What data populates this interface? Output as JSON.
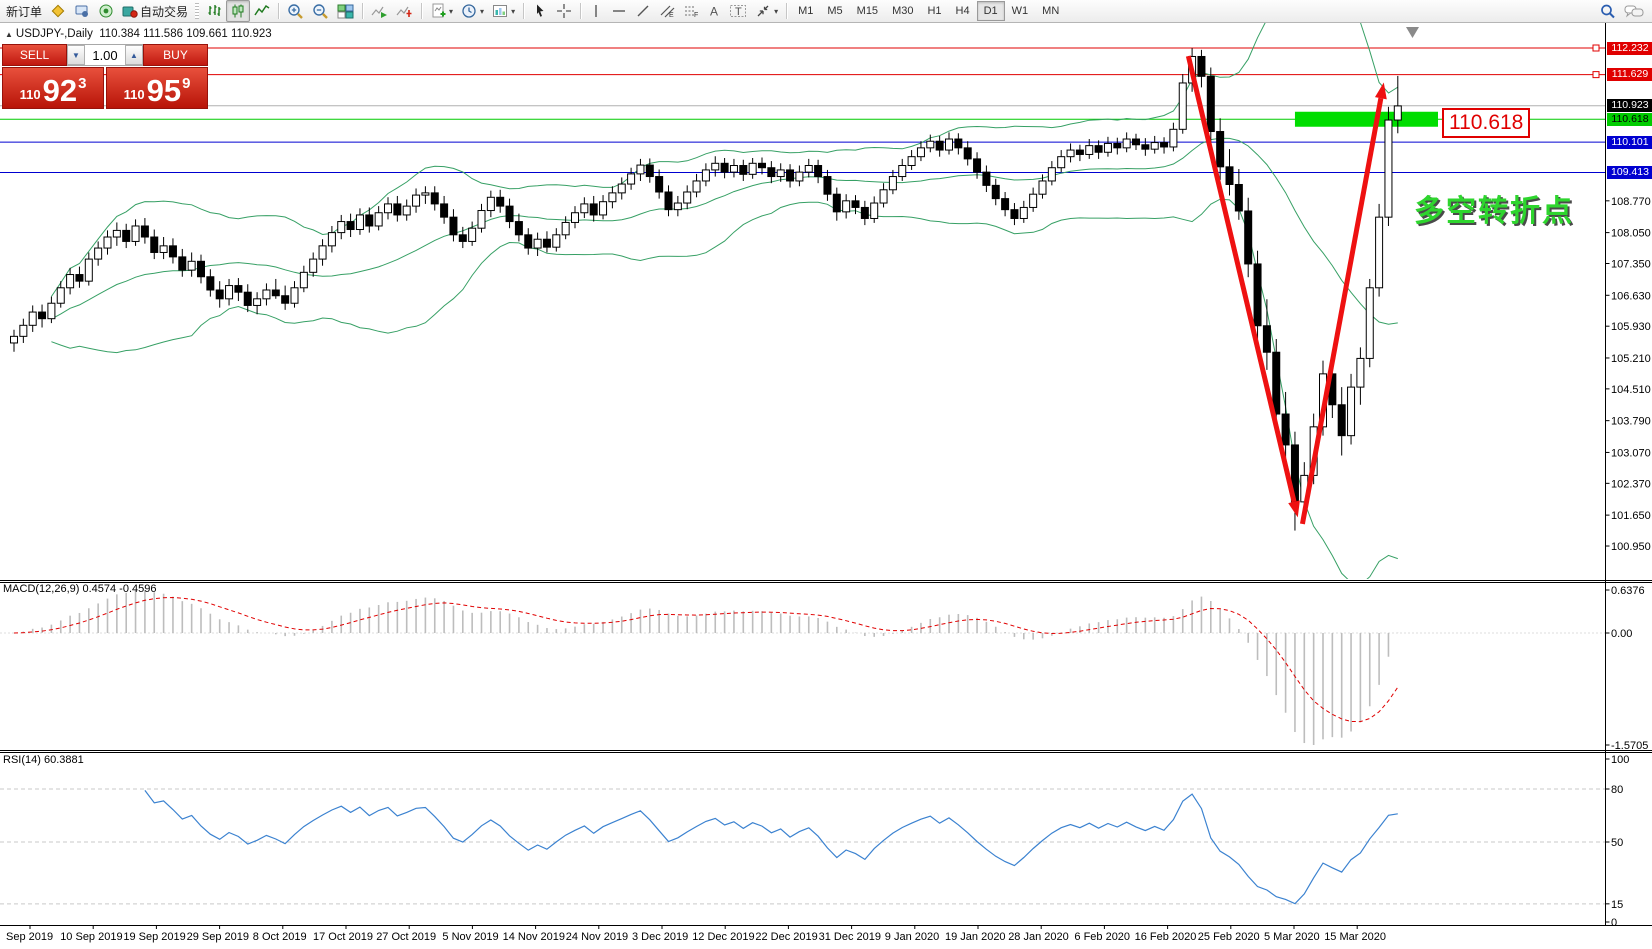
{
  "toolbar": {
    "new_order_label": "新订单",
    "autotrade_label": "自动交易",
    "timeframes": [
      "M1",
      "M5",
      "M15",
      "M30",
      "H1",
      "H4",
      "D1",
      "W1",
      "MN"
    ],
    "active_timeframe": "D1",
    "dropdown_glyph": "▾"
  },
  "chart_header": {
    "collapse_glyph": "▲",
    "title": "USDJPY-,Daily",
    "ohlc": "110.384 111.586 109.661 110.923"
  },
  "trade_panel": {
    "sell_label": "SELL",
    "buy_label": "BUY",
    "volume": "1.00",
    "down_glyph": "▼",
    "up_glyph": "▲",
    "sell_price_prefix": "110",
    "sell_price_main": "92",
    "sell_price_sup": "3",
    "buy_price_prefix": "110",
    "buy_price_main": "95",
    "buy_price_sup": "9"
  },
  "annotations": {
    "turning_point_text": "多空转折点",
    "level_callout": "110.618"
  },
  "indicator_labels": {
    "macd": "MACD(12,26,9) 0.4574 -0.4596",
    "rsi": "RSI(14) 60.3881"
  },
  "chart_data": {
    "type": "candlestick",
    "symbol": "USDJPY-",
    "timeframe": "Daily",
    "ohlc_display": {
      "open": "110.384",
      "high": "111.586",
      "low": "109.661",
      "close": "110.923"
    },
    "price_axis_ticks": [
      "108.770",
      "108.050",
      "107.350",
      "106.630",
      "105.930",
      "105.210",
      "104.510",
      "103.790",
      "103.070",
      "102.370",
      "101.650",
      "100.950"
    ],
    "price_labels": [
      {
        "text": "112.232",
        "price": 112.232,
        "bg": "#e00000",
        "fg": "#ffffff"
      },
      {
        "text": "111.629",
        "price": 111.629,
        "bg": "#e00000",
        "fg": "#ffffff"
      },
      {
        "text": "110.923",
        "price": 110.923,
        "bg": "#000000",
        "fg": "#ffffff"
      },
      {
        "text": "110.618",
        "price": 110.618,
        "bg": "#00cc00",
        "fg": "#000000"
      },
      {
        "text": "110.101",
        "price": 110.101,
        "bg": "#0000d0",
        "fg": "#ffffff"
      },
      {
        "text": "109.413",
        "price": 109.413,
        "bg": "#0000d0",
        "fg": "#ffffff"
      }
    ],
    "h_lines": [
      {
        "price": 112.232,
        "color": "#e00000",
        "handles": true
      },
      {
        "price": 111.629,
        "color": "#e00000",
        "handles": true
      },
      {
        "price": 110.923,
        "color": "#b0b0b0",
        "handles": false
      },
      {
        "price": 110.618,
        "color": "#00cc00",
        "handles": false
      },
      {
        "price": 110.101,
        "color": "#0000d0",
        "handles": false
      },
      {
        "price": 109.413,
        "color": "#0000d0",
        "handles": false
      }
    ],
    "zone": {
      "price": 110.618,
      "bar_start": 137,
      "bar_end": 152.3,
      "color": "#00dd00"
    },
    "arrows": [
      {
        "from_bar": 125.6,
        "from_price": 112.05,
        "to_bar": 137.3,
        "to_price": 101.6
      },
      {
        "from_bar": 137.8,
        "from_price": 101.45,
        "to_bar": 146.5,
        "to_price": 111.45
      }
    ],
    "arrow_color": "#ee1111",
    "bollinger": {
      "period": 20,
      "deviation": 2,
      "color": "#37a065"
    },
    "candles": [
      [
        105.55,
        105.85,
        105.35,
        105.7
      ],
      [
        105.7,
        106.1,
        105.55,
        105.95
      ],
      [
        105.95,
        106.4,
        105.8,
        106.25
      ],
      [
        106.25,
        106.42,
        105.9,
        106.1
      ],
      [
        106.1,
        106.6,
        106.0,
        106.45
      ],
      [
        106.45,
        106.95,
        106.35,
        106.8
      ],
      [
        106.8,
        107.25,
        106.65,
        107.1
      ],
      [
        107.1,
        107.28,
        106.8,
        106.95
      ],
      [
        106.95,
        107.6,
        106.85,
        107.45
      ],
      [
        107.45,
        107.85,
        107.3,
        107.7
      ],
      [
        107.7,
        108.1,
        107.55,
        107.95
      ],
      [
        107.95,
        108.28,
        107.75,
        108.1
      ],
      [
        108.1,
        108.25,
        107.7,
        107.85
      ],
      [
        107.85,
        108.35,
        107.75,
        108.2
      ],
      [
        108.2,
        108.38,
        107.8,
        107.95
      ],
      [
        107.95,
        108.12,
        107.45,
        107.6
      ],
      [
        107.6,
        107.95,
        107.45,
        107.75
      ],
      [
        107.75,
        107.92,
        107.35,
        107.5
      ],
      [
        107.5,
        107.68,
        107.05,
        107.2
      ],
      [
        107.2,
        107.6,
        107.05,
        107.4
      ],
      [
        107.4,
        107.55,
        106.9,
        107.05
      ],
      [
        107.05,
        107.22,
        106.6,
        106.75
      ],
      [
        106.75,
        106.95,
        106.35,
        106.55
      ],
      [
        106.55,
        107.0,
        106.4,
        106.85
      ],
      [
        106.85,
        107.02,
        106.5,
        106.7
      ],
      [
        106.7,
        106.88,
        106.25,
        106.4
      ],
      [
        106.4,
        106.7,
        106.2,
        106.55
      ],
      [
        106.55,
        106.9,
        106.4,
        106.75
      ],
      [
        106.75,
        107.0,
        106.55,
        106.62
      ],
      [
        106.62,
        106.85,
        106.3,
        106.45
      ],
      [
        106.45,
        106.95,
        106.35,
        106.8
      ],
      [
        106.8,
        107.3,
        106.7,
        107.15
      ],
      [
        107.15,
        107.6,
        107.05,
        107.45
      ],
      [
        107.45,
        107.9,
        107.3,
        107.75
      ],
      [
        107.75,
        108.2,
        107.6,
        108.05
      ],
      [
        108.05,
        108.45,
        107.9,
        108.3
      ],
      [
        108.3,
        108.48,
        107.95,
        108.12
      ],
      [
        108.12,
        108.6,
        108.0,
        108.45
      ],
      [
        108.45,
        108.62,
        108.05,
        108.2
      ],
      [
        108.2,
        108.65,
        108.1,
        108.5
      ],
      [
        108.5,
        108.85,
        108.35,
        108.7
      ],
      [
        108.7,
        108.88,
        108.3,
        108.45
      ],
      [
        108.45,
        108.8,
        108.32,
        108.65
      ],
      [
        108.65,
        109.05,
        108.5,
        108.9
      ],
      [
        108.9,
        109.1,
        108.7,
        108.95
      ],
      [
        108.95,
        109.1,
        108.55,
        108.7
      ],
      [
        108.7,
        108.88,
        108.25,
        108.4
      ],
      [
        108.4,
        108.58,
        107.85,
        108.0
      ],
      [
        108.0,
        108.18,
        107.7,
        107.85
      ],
      [
        107.85,
        108.3,
        107.75,
        108.15
      ],
      [
        108.15,
        108.7,
        108.05,
        108.55
      ],
      [
        108.55,
        109.0,
        108.4,
        108.85
      ],
      [
        108.85,
        109.02,
        108.5,
        108.65
      ],
      [
        108.65,
        108.82,
        108.15,
        108.3
      ],
      [
        108.3,
        108.48,
        107.85,
        108.0
      ],
      [
        108.0,
        108.15,
        107.55,
        107.7
      ],
      [
        107.7,
        108.05,
        107.52,
        107.9
      ],
      [
        107.9,
        108.08,
        107.6,
        107.72
      ],
      [
        107.72,
        108.15,
        107.62,
        108.0
      ],
      [
        108.0,
        108.42,
        107.9,
        108.28
      ],
      [
        108.28,
        108.65,
        108.15,
        108.5
      ],
      [
        108.5,
        108.85,
        108.38,
        108.7
      ],
      [
        108.7,
        108.88,
        108.3,
        108.45
      ],
      [
        108.45,
        108.9,
        108.35,
        108.75
      ],
      [
        108.75,
        109.1,
        108.6,
        108.95
      ],
      [
        108.95,
        109.3,
        108.8,
        109.15
      ],
      [
        109.15,
        109.52,
        109.02,
        109.38
      ],
      [
        109.38,
        109.72,
        109.22,
        109.58
      ],
      [
        109.58,
        109.73,
        109.18,
        109.32
      ],
      [
        109.32,
        109.48,
        108.82,
        108.97
      ],
      [
        108.97,
        109.12,
        108.42,
        108.57
      ],
      [
        108.57,
        108.88,
        108.42,
        108.72
      ],
      [
        108.72,
        109.12,
        108.58,
        108.97
      ],
      [
        108.97,
        109.38,
        108.85,
        109.22
      ],
      [
        109.22,
        109.62,
        109.1,
        109.47
      ],
      [
        109.47,
        109.78,
        109.32,
        109.62
      ],
      [
        109.62,
        109.74,
        109.28,
        109.42
      ],
      [
        109.42,
        109.72,
        109.3,
        109.57
      ],
      [
        109.57,
        109.7,
        109.22,
        109.37
      ],
      [
        109.37,
        109.74,
        109.27,
        109.62
      ],
      [
        109.62,
        109.75,
        109.37,
        109.52
      ],
      [
        109.52,
        109.67,
        109.17,
        109.32
      ],
      [
        109.32,
        109.62,
        109.2,
        109.47
      ],
      [
        109.47,
        109.6,
        109.07,
        109.22
      ],
      [
        109.22,
        109.57,
        109.1,
        109.42
      ],
      [
        109.42,
        109.72,
        109.3,
        109.57
      ],
      [
        109.57,
        109.7,
        109.17,
        109.32
      ],
      [
        109.32,
        109.47,
        108.77,
        108.92
      ],
      [
        108.92,
        109.07,
        108.32,
        108.52
      ],
      [
        108.52,
        108.92,
        108.37,
        108.77
      ],
      [
        108.77,
        108.9,
        108.47,
        108.62
      ],
      [
        108.62,
        108.77,
        108.22,
        108.37
      ],
      [
        108.37,
        108.87,
        108.27,
        108.72
      ],
      [
        108.72,
        109.17,
        108.62,
        109.02
      ],
      [
        109.02,
        109.47,
        108.92,
        109.32
      ],
      [
        109.32,
        109.72,
        109.22,
        109.57
      ],
      [
        109.57,
        109.92,
        109.47,
        109.77
      ],
      [
        109.77,
        110.12,
        109.67,
        109.97
      ],
      [
        109.97,
        110.27,
        109.87,
        110.12
      ],
      [
        110.12,
        110.24,
        109.77,
        109.92
      ],
      [
        109.92,
        110.32,
        109.82,
        110.17
      ],
      [
        110.17,
        110.3,
        109.82,
        109.97
      ],
      [
        109.97,
        110.12,
        109.57,
        109.72
      ],
      [
        109.72,
        109.87,
        109.27,
        109.42
      ],
      [
        109.42,
        109.57,
        108.97,
        109.12
      ],
      [
        109.12,
        109.27,
        108.67,
        108.82
      ],
      [
        108.82,
        108.97,
        108.42,
        108.57
      ],
      [
        108.57,
        108.72,
        108.22,
        108.37
      ],
      [
        108.37,
        108.77,
        108.27,
        108.62
      ],
      [
        108.62,
        109.07,
        108.52,
        108.92
      ],
      [
        108.92,
        109.37,
        108.82,
        109.22
      ],
      [
        109.22,
        109.67,
        109.12,
        109.52
      ],
      [
        109.52,
        109.92,
        109.42,
        109.77
      ],
      [
        109.77,
        110.07,
        109.64,
        109.92
      ],
      [
        109.92,
        110.04,
        109.67,
        109.82
      ],
      [
        109.82,
        110.17,
        109.72,
        110.02
      ],
      [
        110.02,
        110.14,
        109.72,
        109.87
      ],
      [
        109.87,
        110.22,
        109.77,
        110.07
      ],
      [
        110.07,
        110.2,
        109.82,
        109.97
      ],
      [
        109.97,
        110.32,
        109.87,
        110.17
      ],
      [
        110.17,
        110.29,
        109.92,
        110.04
      ],
      [
        110.04,
        110.19,
        109.79,
        109.94
      ],
      [
        109.94,
        110.24,
        109.84,
        110.09
      ],
      [
        110.09,
        110.21,
        109.84,
        109.99
      ],
      [
        109.99,
        110.54,
        109.89,
        110.39
      ],
      [
        110.39,
        111.64,
        110.29,
        111.44
      ],
      [
        111.44,
        112.23,
        111.24,
        112.04
      ],
      [
        112.04,
        112.19,
        111.34,
        111.59
      ],
      [
        111.59,
        111.79,
        110.09,
        110.34
      ],
      [
        110.34,
        110.64,
        109.24,
        109.54
      ],
      [
        109.54,
        109.94,
        108.89,
        109.14
      ],
      [
        109.14,
        109.49,
        108.34,
        108.54
      ],
      [
        108.54,
        108.84,
        107.04,
        107.34
      ],
      [
        107.34,
        107.64,
        105.64,
        105.94
      ],
      [
        105.94,
        106.54,
        104.94,
        105.34
      ],
      [
        105.34,
        105.64,
        103.54,
        103.94
      ],
      [
        103.94,
        104.44,
        102.94,
        103.24
      ],
      [
        103.24,
        103.54,
        101.3,
        101.95
      ],
      [
        101.95,
        102.85,
        101.45,
        102.55
      ],
      [
        102.55,
        103.95,
        102.35,
        103.65
      ],
      [
        103.65,
        105.15,
        103.45,
        104.85
      ],
      [
        104.85,
        105.05,
        103.85,
        104.15
      ],
      [
        104.15,
        104.55,
        103.0,
        103.45
      ],
      [
        103.45,
        104.85,
        103.25,
        104.55
      ],
      [
        104.55,
        105.45,
        104.15,
        105.2
      ],
      [
        105.2,
        107.0,
        105.0,
        106.8
      ],
      [
        106.8,
        108.7,
        106.6,
        108.4
      ],
      [
        108.4,
        110.9,
        108.2,
        110.6
      ],
      [
        110.6,
        111.6,
        110.3,
        110.92
      ]
    ],
    "x_axis_dates": [
      "Sep 2019",
      "10 Sep 2019",
      "19 Sep 2019",
      "29 Sep 2019",
      "8 Oct 2019",
      "17 Oct 2019",
      "27 Oct 2019",
      "5 Nov 2019",
      "14 Nov 2019",
      "24 Nov 2019",
      "3 Dec 2019",
      "12 Dec 2019",
      "22 Dec 2019",
      "31 Dec 2019",
      "9 Jan 2020",
      "19 Jan 2020",
      "28 Jan 2020",
      "6 Feb 2020",
      "16 Feb 2020",
      "25 Feb 2020",
      "5 Mar 2020",
      "15 Mar 2020"
    ],
    "macd": {
      "fast": 12,
      "slow": 26,
      "signal": 9,
      "value": "0.4574",
      "signal_value": "-0.4596",
      "max_label": "0.6376",
      "zero_label": "0.00",
      "min_label": "-1.5705",
      "bar_color": "#bdbdbd",
      "signal_color": "#e00000"
    },
    "rsi": {
      "period": 14,
      "value": "60.3881",
      "color": "#3b82d0",
      "axis_values": [
        100,
        80,
        50,
        15,
        0
      ],
      "level_lines": [
        80,
        50,
        15
      ]
    }
  }
}
